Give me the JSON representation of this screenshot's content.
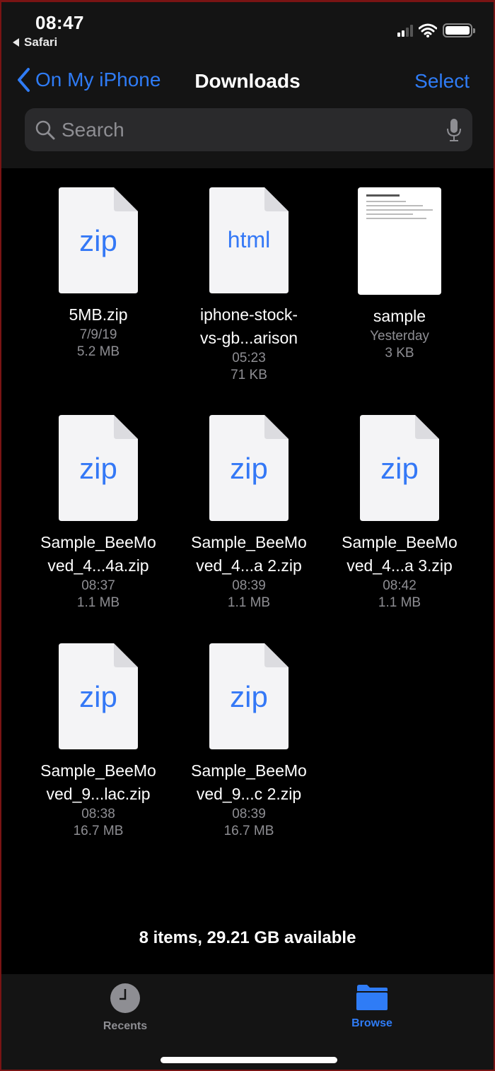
{
  "status_bar": {
    "time": "08:47",
    "back_app": "Safari",
    "signal_bars": 2,
    "signal_bars_total": 4,
    "battery_level": 1.0
  },
  "nav": {
    "back_label": "On My iPhone",
    "title": "Downloads",
    "select_label": "Select"
  },
  "search": {
    "placeholder": "Search",
    "value": ""
  },
  "files": [
    {
      "type": "zip",
      "ext_label": "zip",
      "name_line1": "5MB.zip",
      "name_line2": "",
      "date": "7/9/19",
      "size": "5.2 MB"
    },
    {
      "type": "html",
      "ext_label": "html",
      "name_line1": "iphone-stock-",
      "name_line2": "vs-gb...arison",
      "date": "05:23",
      "size": "71 KB"
    },
    {
      "type": "pdf",
      "ext_label": "",
      "name_line1": "sample",
      "name_line2": "",
      "date": "Yesterday",
      "size": "3 KB"
    },
    {
      "type": "zip",
      "ext_label": "zip",
      "name_line1": "Sample_BeeMo",
      "name_line2": "ved_4...4a.zip",
      "date": "08:37",
      "size": "1.1 MB"
    },
    {
      "type": "zip",
      "ext_label": "zip",
      "name_line1": "Sample_BeeMo",
      "name_line2": "ved_4...a 2.zip",
      "date": "08:39",
      "size": "1.1 MB"
    },
    {
      "type": "zip",
      "ext_label": "zip",
      "name_line1": "Sample_BeeMo",
      "name_line2": "ved_4...a 3.zip",
      "date": "08:42",
      "size": "1.1 MB"
    },
    {
      "type": "zip",
      "ext_label": "zip",
      "name_line1": "Sample_BeeMo",
      "name_line2": "ved_9...lac.zip",
      "date": "08:38",
      "size": "16.7 MB"
    },
    {
      "type": "zip",
      "ext_label": "zip",
      "name_line1": "Sample_BeeMo",
      "name_line2": "ved_9...c 2.zip",
      "date": "08:39",
      "size": "16.7 MB"
    }
  ],
  "summary": "8 items, 29.21 GB available",
  "tabs": [
    {
      "label": "Recents",
      "icon": "clock-icon",
      "active": false
    },
    {
      "label": "Browse",
      "icon": "folder-icon",
      "active": true
    }
  ],
  "colors": {
    "accent": "#2f7cf6",
    "inactive_tab": "#8e8e93",
    "header_bg": "#141414",
    "content_bg": "#000000"
  }
}
